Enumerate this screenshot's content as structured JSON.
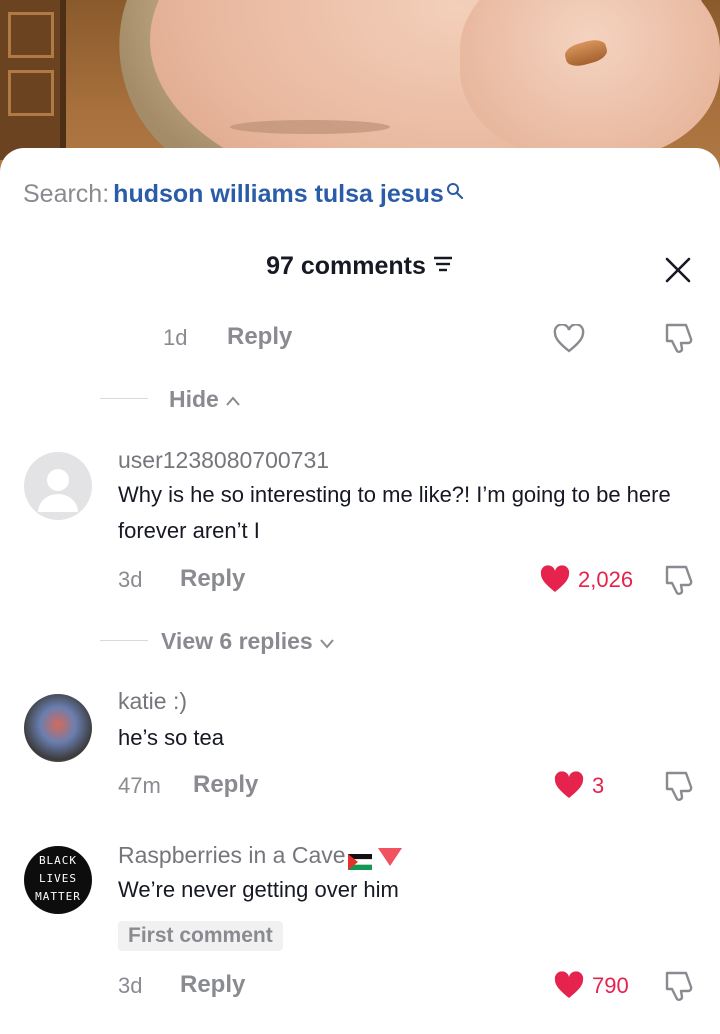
{
  "search": {
    "label": "Search:",
    "query": "hudson williams tulsa jesus"
  },
  "header": {
    "count_label": "97 comments"
  },
  "colors": {
    "like_red": "#e5234d",
    "search_blue": "#2b5ca8",
    "muted": "#8a8b91"
  },
  "top_partial": {
    "age": "1d",
    "reply": "Reply"
  },
  "hide": {
    "label": "Hide"
  },
  "comments": [
    {
      "username": "user1238080700731",
      "text": "Why is he so interesting to me like?! I’m going to be here forever aren’t I",
      "age": "3d",
      "reply": "Reply",
      "likes": "2,026",
      "view_replies": "View 6 replies"
    },
    {
      "username": "katie :)",
      "text": "he’s so tea",
      "age": "47m",
      "reply": "Reply",
      "likes": "3"
    },
    {
      "username": "Raspberries in a Cave",
      "text": "We’re never getting over him",
      "badge": "First comment",
      "avatar_text": [
        "BLACK",
        "LIVES",
        "MATTER"
      ],
      "age": "3d",
      "reply": "Reply",
      "likes": "790"
    }
  ],
  "icons": [
    "search-icon",
    "sort-icon",
    "close-icon",
    "heart-icon",
    "dislike-icon",
    "chevron-up-icon",
    "chevron-down-icon",
    "default-avatar-icon"
  ]
}
